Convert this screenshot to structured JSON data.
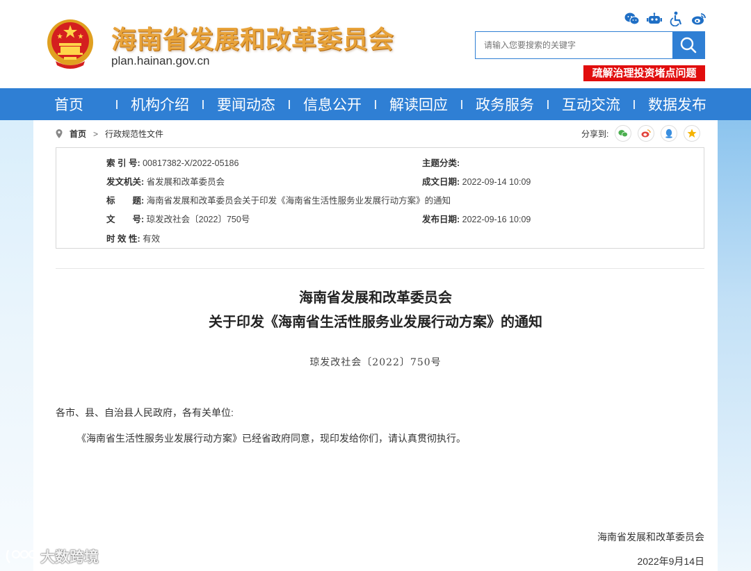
{
  "header": {
    "site_title": "海南省发展和改革委员会",
    "site_url": "plan.hainan.gov.cn",
    "tool_icons": [
      "wechat-icon",
      "robot-icon",
      "accessibility-icon",
      "weibo-icon"
    ],
    "search_placeholder": "请输入您要搜索的关键字",
    "promo_label": "疏解治理投资堵点问题"
  },
  "nav": {
    "items": [
      "首页",
      "机构介绍",
      "要闻动态",
      "信息公开",
      "解读回应",
      "政务服务",
      "互动交流",
      "数据发布"
    ]
  },
  "breadcrumb": {
    "home": "首页",
    "separator": ">",
    "current": "行政规范性文件"
  },
  "share": {
    "label": "分享到:",
    "icons": [
      "wechat-icon",
      "weibo-icon",
      "qq-icon",
      "qzone-icon"
    ]
  },
  "meta": {
    "index_label": "索 引 号:",
    "index_value": "00817382-X/2022-05186",
    "topic_label": "主题分类:",
    "topic_value": "",
    "issuer_label": "发文机关:",
    "issuer_value": "省发展和改革委员会",
    "created_label": "成文日期:",
    "created_value": "2022-09-14 10:09",
    "title_label": "标　　题:",
    "title_value": "海南省发展和改革委员会关于印发《海南省生活性服务业发展行动方案》的通知",
    "docno_label": "文　　号:",
    "docno_value": "琼发改社会〔2022〕750号",
    "published_label": "发布日期:",
    "published_value": "2022-09-16 10:09",
    "validity_label": "时 效 性:",
    "validity_value": "有效"
  },
  "article": {
    "title_line1": "海南省发展和改革委员会",
    "title_line2": "关于印发《海南省生活性服务业发展行动方案》的通知",
    "doc_number": "琼发改社会〔2022〕750号",
    "salutation": "各市、县、自治县人民政府，各有关单位:",
    "body": "《海南省生活性服务业发展行动方案》已经省政府同意，现印发给你们，请认真贯彻执行。",
    "signature": "海南省发展和改革委员会",
    "date": "2022年9月14日"
  },
  "watermark": {
    "text": "大数跨境"
  },
  "colors": {
    "nav_blue": "#2f7fd4",
    "promo_red": "#e10d0d",
    "title_gold": "#e8a33a"
  }
}
